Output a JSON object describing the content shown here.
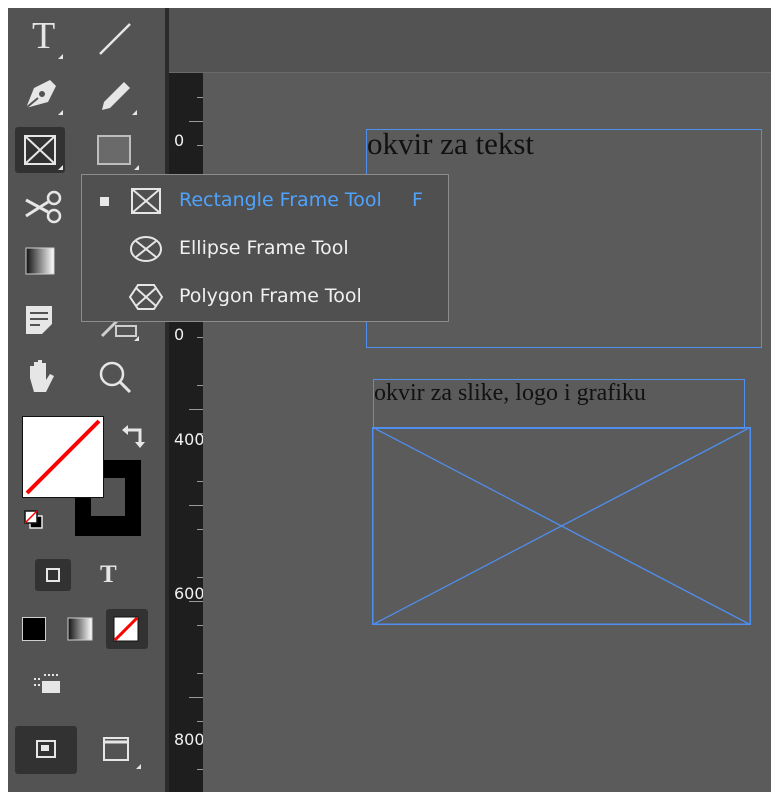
{
  "colors": {
    "selection_frame": "#4f8ff0",
    "flyout_active": "#4ea3ff",
    "panel_bg": "#535353",
    "ruler_bg": "#1e1e1e",
    "stroke_none": "#ff0000"
  },
  "toolbar": {
    "tools": [
      {
        "name": "type-tool",
        "icon": "type-icon"
      },
      {
        "name": "line-tool",
        "icon": "line-icon"
      },
      {
        "name": "pen-tool",
        "icon": "pen-icon"
      },
      {
        "name": "pencil-tool",
        "icon": "pencil-icon"
      },
      {
        "name": "rectangle-frame-tool",
        "icon": "rectangle-frame-icon",
        "selected": true
      },
      {
        "name": "rectangle-tool",
        "icon": "rectangle-icon"
      },
      {
        "name": "scissors-tool",
        "icon": "scissors-icon"
      },
      {
        "name": "gradient-swatch-tool",
        "icon": "gradient-icon"
      },
      {
        "name": "note-tool",
        "icon": "note-icon"
      },
      {
        "name": "measure-tool",
        "icon": "eyedropper-icon"
      },
      {
        "name": "hand-tool",
        "icon": "hand-icon"
      },
      {
        "name": "zoom-tool",
        "icon": "magnifier-icon"
      }
    ],
    "type_glyph": "T",
    "format_text_glyph": "T"
  },
  "ruler": {
    "labels": [
      "0",
      "0",
      "400",
      "600",
      "800"
    ]
  },
  "flyout": {
    "items": [
      {
        "label": "Rectangle Frame Tool",
        "shortcut": "F",
        "icon": "rectangle-frame-icon",
        "active": true
      },
      {
        "label": "Ellipse Frame Tool",
        "shortcut": "",
        "icon": "ellipse-frame-icon",
        "active": false
      },
      {
        "label": "Polygon Frame Tool",
        "shortcut": "",
        "icon": "polygon-frame-icon",
        "active": false
      }
    ]
  },
  "canvas": {
    "text_frame_label": "okvir za tekst",
    "image_frame_label": "okvir za slike, logo i grafiku"
  }
}
